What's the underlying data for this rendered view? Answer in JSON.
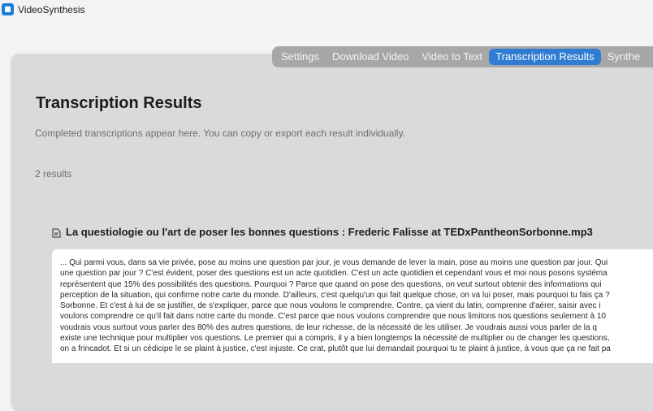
{
  "app": {
    "title": "VideoSynthesis",
    "icon": "app-icon"
  },
  "tabs": [
    {
      "label": "Settings",
      "active": false
    },
    {
      "label": "Download Video",
      "active": false
    },
    {
      "label": "Video to Text",
      "active": false
    },
    {
      "label": "Transcription Results",
      "active": true
    },
    {
      "label": "Synthe",
      "active": false
    }
  ],
  "page": {
    "title": "Transcription Results",
    "subtitle": "Completed transcriptions appear here. You can copy or export each result individually.",
    "count": "2 results"
  },
  "result": {
    "icon": "file-icon",
    "title": "La questiologie ou l'art de poser les bonnes questions :  Frederic Falisse at TEDxPantheonSorbonne.mp3",
    "lines": [
      "... Qui parmi vous, dans sa vie privée, pose au moins une question par jour, je vous demande de lever la main, pose au moins une question par jour. Qui",
      "une question par jour ? C'est évident, poser des questions est un acte quotidien. C'est un acte quotidien et cependant vous et moi nous posons systéma",
      "représentent que 15% des possibilités des questions. Pourquoi ? Parce que quand on pose des questions, on veut surtout obtenir des informations qui",
      "perception de la situation, qui confirme notre carte du monde. D'ailleurs, c'est quelqu'un qui fait quelque chose, on va lui poser, mais pourquoi tu fais ça ?",
      "Sorbonne. Et c'est à lui de se justifier, de s'expliquer, parce que nous voulons le comprendre. Contre, ça vient du latin, comprenne d'aérer, saisir avec i",
      "voulons comprendre ce qu'il fait dans notre carte du monde. C'est parce que nous voulons comprendre que nous limitons nos questions seulement à 10",
      "voudrais vous surtout vous parler des 80% des autres questions, de leur richesse, de la nécessité de les utiliser. Je voudrais aussi vous parler de la q",
      "existe une technique pour multiplier vos questions. Le premier qui a compris, il y a bien longtemps la nécessité de multiplier ou de changer les questions,",
      "on a frincadot. Et si un cédicipe le se plaint à justice, c'est injuste. Ce crat, plutôt que lui demandait pourquoi tu te plaint à justice, à vous que ça ne fait pa"
    ]
  },
  "colors": {
    "accent": "#2f7cd2",
    "panel": "#dadada",
    "tabbar": "#a7a7a7"
  }
}
